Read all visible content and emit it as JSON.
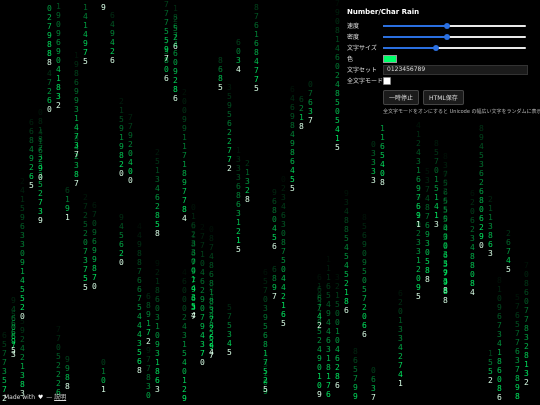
{
  "panel": {
    "title": "Number/Char Rain",
    "speed": {
      "label": "速度",
      "value": 0.45
    },
    "density": {
      "label": "密度",
      "value": 0.45
    },
    "font_size": {
      "label": "文字サイズ",
      "value": 0.37
    },
    "color": {
      "label": "色",
      "value": "#00ff6a"
    },
    "charset": {
      "label": "文字セット",
      "value": "0123456789"
    },
    "all_chars_mode": {
      "label": "全文字モード",
      "checked": false
    },
    "pause_button": "一時停止",
    "save_html_button": "HTML保存",
    "note": "全文字モードをオンにすると Unicode の幅広い文字をランダムに表示します。"
  },
  "footer": {
    "made_with": "Made with",
    "heart_icon": "heart-icon",
    "link": "説明"
  },
  "rain": {
    "charset": "0123456789",
    "color": "#00ff6a",
    "background": "#000000"
  }
}
